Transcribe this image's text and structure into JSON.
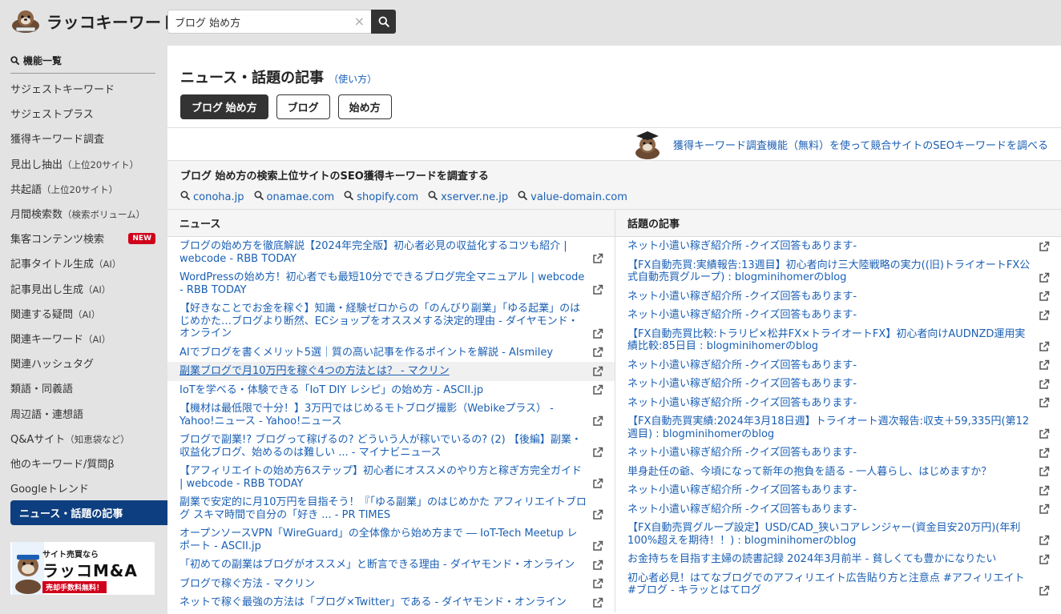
{
  "app": {
    "logo_text": "ラッコキーワード"
  },
  "search": {
    "value": "ブログ 始め方",
    "clear": "×"
  },
  "sidebar": {
    "heading": "機能一覧",
    "items": [
      {
        "label": "サジェストキーワード",
        "sub": ""
      },
      {
        "label": "サジェストプラス",
        "sub": ""
      },
      {
        "label": "獲得キーワード調査",
        "sub": ""
      },
      {
        "label": "見出し抽出",
        "sub": "（上位20サイト）"
      },
      {
        "label": "共起語",
        "sub": "（上位20サイト）"
      },
      {
        "label": "月間検索数",
        "sub": "（検索ボリューム）"
      },
      {
        "label": "集客コンテンツ検索",
        "sub": "",
        "badge": "NEW"
      },
      {
        "label": "記事タイトル生成",
        "sub": "（AI）"
      },
      {
        "label": "記事見出し生成",
        "sub": "（AI）"
      },
      {
        "label": "関連する疑問",
        "sub": "（AI）"
      },
      {
        "label": "関連キーワード",
        "sub": "（AI）"
      },
      {
        "label": "関連ハッシュタグ",
        "sub": ""
      },
      {
        "label": "類語・同義語",
        "sub": ""
      },
      {
        "label": "周辺語・連想語",
        "sub": ""
      },
      {
        "label": "Q&Aサイト",
        "sub": "（知恵袋など）"
      },
      {
        "label": "他のキーワード/質問β",
        "sub": ""
      },
      {
        "label": "Googleトレンド",
        "sub": ""
      },
      {
        "label": "ニュース・話題の記事",
        "sub": "",
        "active": true
      }
    ],
    "banner": {
      "small": "サイト売買なら",
      "big": "ラッコM&A",
      "red": "売却手数料無料！"
    }
  },
  "main": {
    "title": "ニュース・話題の記事",
    "howto": "（使い方）",
    "chips": [
      "ブログ 始め方",
      "ブログ",
      "始め方"
    ],
    "promo_link": "獲得キーワード調査機能（無料）を使って競合サイトのSEOキーワードを調べる",
    "seo_title": "ブログ 始め方の検索上位サイトのSEO獲得キーワードを調査する",
    "seo_links": [
      "conoha.jp",
      "onamae.com",
      "shopify.com",
      "xserver.ne.jp",
      "value-domain.com"
    ],
    "news_header": "ニュース",
    "topics_header": "話題の記事",
    "news": [
      "ブログの始め方を徹底解説【2024年完全版】初心者必見の収益化するコツも紹介 | webcode - RBB TODAY",
      "WordPressの始め方！初心者でも最短10分でできるブログ完全マニュアル | webcode - RBB TODAY",
      "【好きなことでお金を稼ぐ】知識・経験ゼロからの「のんびり副業」「ゆる起業」のはじめかた…ブログより断然、ECショップをオススメする決定的理由 - ダイヤモンド・オンライン",
      "AIでブログを書くメリット5選｜質の高い記事を作るポイントを解説 - AIsmiley",
      "副業ブログで月10万円を稼ぐ4つの方法とは？ - マクリン",
      "IoTを学べる・体験できる「IoT DIY レシピ」の始め方 - ASCII.jp",
      "【機材は最低限で十分！】3万円ではじめるモトブログ撮影（Webikeプラス） - Yahoo!ニュース - Yahoo!ニュース",
      "ブログで副業!? ブログって稼げるの? どういう人が稼いでいるの? (2) 【後編】副業・収益化ブログ、始めるのは難しい ... - マイナビニュース",
      "【アフィリエイトの始め方6ステップ】初心者にオススメのやり方と稼ぎ方完全ガイド | webcode - RBB TODAY",
      "副業で安定的に月10万円を目指そう！『「ゆる副業」のはじめかた アフィリエイトブログ スキマ時間で自分の「好き ... - PR TIMES",
      "オープンソースVPN「WireGuard」の全体像から始め方まで ― IoT-Tech Meetup レポート - ASCII.jp",
      "「初めての副業はブログがオススメ」と断言できる理由 - ダイヤモンド・オンライン",
      "ブログで稼ぐ方法 - マクリン",
      "ネットで稼ぐ最強の方法は「ブログ×Twitter」である - ダイヤモンド・オンライン"
    ],
    "topics": [
      "ネット小遣い稼ぎ紹介所 -クイズ回答もあります-",
      "【FX自動売買:実績報告:13週目】初心者向け三大陸戦略の実力((旧)トライオートFX公式自動売買グループ) : blogminihomerのblog",
      "ネット小遣い稼ぎ紹介所 -クイズ回答もあります-",
      "ネット小遣い稼ぎ紹介所 -クイズ回答もあります-",
      "【FX自動売買比較:トラリピ×松井FX×トライオートFX】初心者向けAUDNZD運用実績比較:85日目 : blogminihomerのblog",
      "ネット小遣い稼ぎ紹介所 -クイズ回答もあります-",
      "ネット小遣い稼ぎ紹介所 -クイズ回答もあります-",
      "ネット小遣い稼ぎ紹介所 -クイズ回答もあります-",
      "【FX自動売買実績:2024年3月18日週】トライオート週次報告:収支＋59,335円(第12週目) : blogminihomerのblog",
      "ネット小遣い稼ぎ紹介所 -クイズ回答もあります-",
      "単身赴任の爺、今頃になって新年の抱負を語る - 一人暮らし、はじめますか？",
      "ネット小遣い稼ぎ紹介所 -クイズ回答もあります-",
      "ネット小遣い稼ぎ紹介所 -クイズ回答もあります-",
      "【FX自動売買グループ設定】USD/CAD_狭いコアレンジャー(資金目安20万円)(年利100%超えを期待！！) : blogminihomerのblog",
      "お金持ちを目指す主婦の読書記録 2024年3月前半 - 貧しくても豊かになりたい",
      "初心者必見！はてなブログでのアフィリエイト広告貼り方と注意点 #アフィリエイト #ブログ - キラッとはてログ"
    ],
    "highlighted_news_index": 4
  }
}
